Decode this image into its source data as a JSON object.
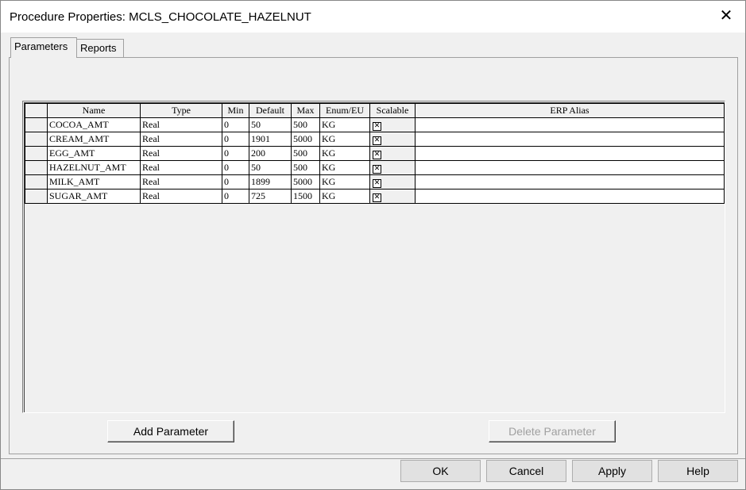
{
  "window": {
    "title": "Procedure Properties:  MCLS_CHOCOLATE_HAZELNUT",
    "close_glyph": "✕"
  },
  "tabs": [
    {
      "label": "Parameters",
      "active": true
    },
    {
      "label": "Reports",
      "active": false
    }
  ],
  "grid": {
    "columns": [
      "Name",
      "Type",
      "Min",
      "Default",
      "Max",
      "Enum/EU",
      "Scalable",
      "ERP Alias"
    ],
    "rows": [
      {
        "name": "COCOA_AMT",
        "type": "Real",
        "min": "0",
        "default": "50",
        "max": "500",
        "eu": "KG",
        "scalable": "✕",
        "erp_alias": ""
      },
      {
        "name": "CREAM_AMT",
        "type": "Real",
        "min": "0",
        "default": "1901",
        "max": "5000",
        "eu": "KG",
        "scalable": "✕",
        "erp_alias": ""
      },
      {
        "name": "EGG_AMT",
        "type": "Real",
        "min": "0",
        "default": "200",
        "max": "500",
        "eu": "KG",
        "scalable": "✕",
        "erp_alias": ""
      },
      {
        "name": "HAZELNUT_AMT",
        "type": "Real",
        "min": "0",
        "default": "50",
        "max": "500",
        "eu": "KG",
        "scalable": "✕",
        "erp_alias": ""
      },
      {
        "name": "MILK_AMT",
        "type": "Real",
        "min": "0",
        "default": "1899",
        "max": "5000",
        "eu": "KG",
        "scalable": "✕",
        "erp_alias": ""
      },
      {
        "name": "SUGAR_AMT",
        "type": "Real",
        "min": "0",
        "default": "725",
        "max": "1500",
        "eu": "KG",
        "scalable": "✕",
        "erp_alias": ""
      }
    ]
  },
  "buttons": {
    "add_parameter": "Add Parameter",
    "delete_parameter": "Delete Parameter",
    "ok": "OK",
    "cancel": "Cancel",
    "apply": "Apply",
    "help": "Help"
  }
}
